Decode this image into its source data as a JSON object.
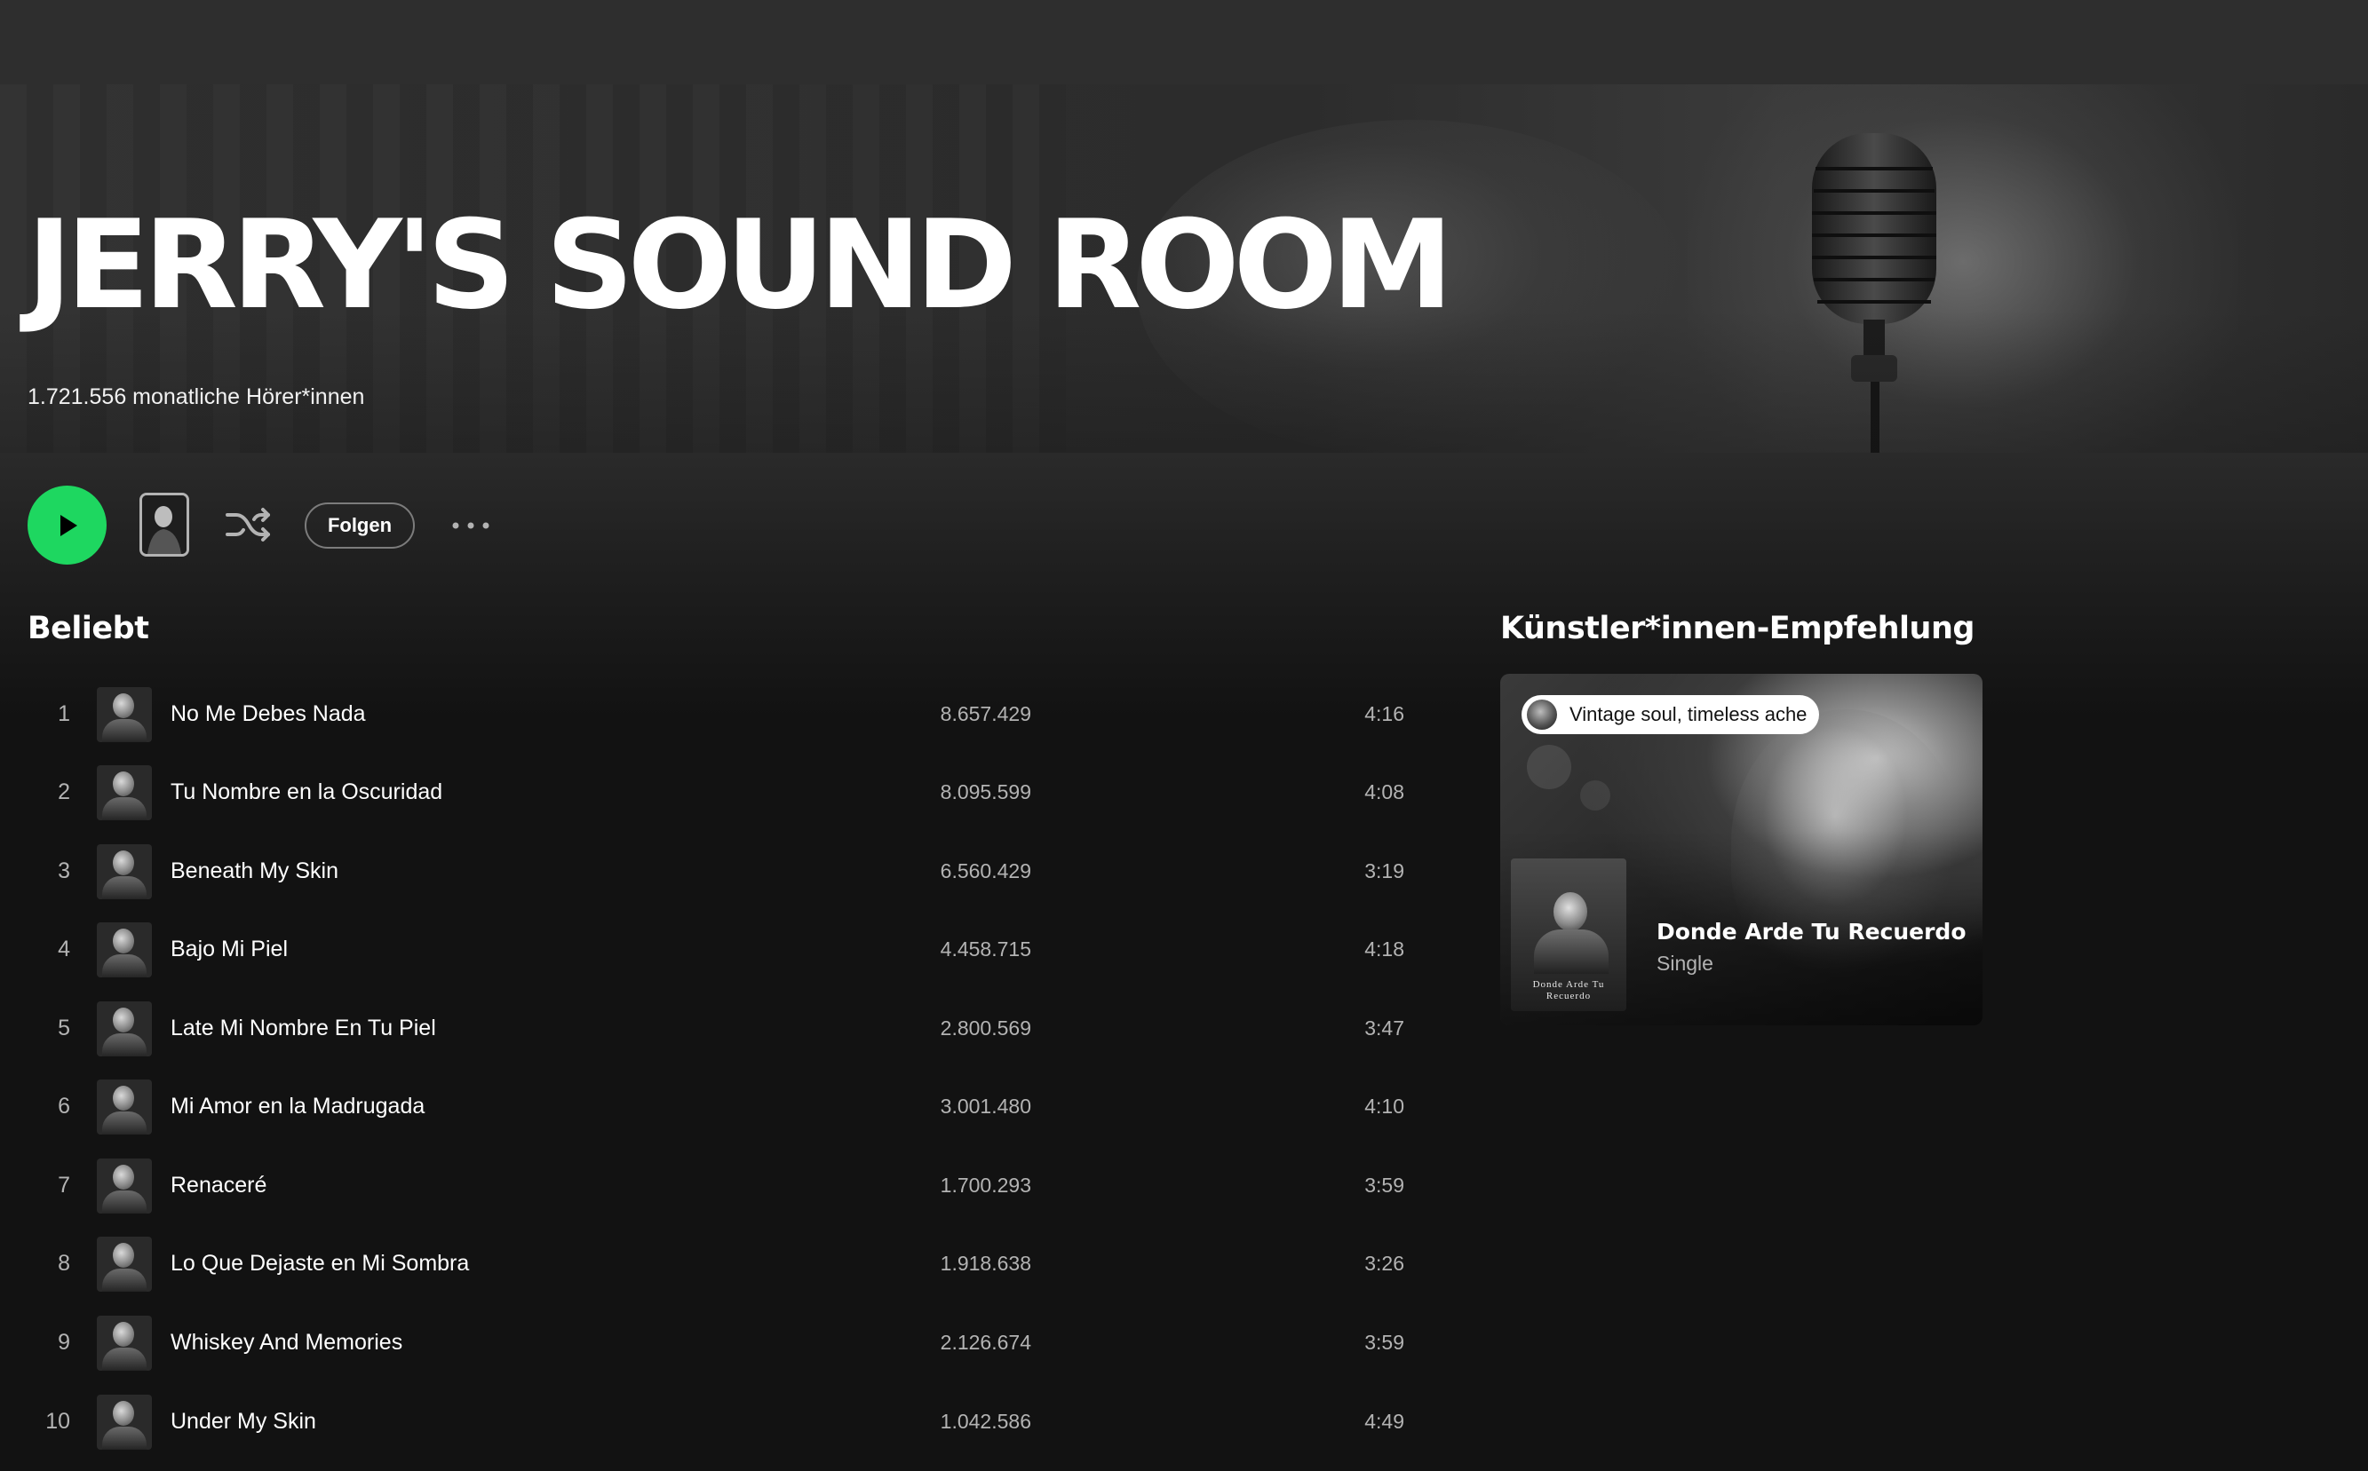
{
  "artist": {
    "name": "JERRY'S SOUND ROOM",
    "monthly_listeners": "1.721.556 monatliche Hörer*innen"
  },
  "controls": {
    "play": "play-icon",
    "shuffle": "shuffle-icon",
    "follow_label": "Folgen",
    "more": "more-options-icon",
    "accent_color": "#1ed760"
  },
  "popular": {
    "title": "Beliebt",
    "tracks": [
      {
        "rank": "1",
        "title": "No Me Debes Nada",
        "plays": "8.657.429",
        "duration": "4:16"
      },
      {
        "rank": "2",
        "title": "Tu Nombre en la Oscuridad",
        "plays": "8.095.599",
        "duration": "4:08"
      },
      {
        "rank": "3",
        "title": "Beneath My Skin",
        "plays": "6.560.429",
        "duration": "3:19"
      },
      {
        "rank": "4",
        "title": "Bajo Mi Piel",
        "plays": "4.458.715",
        "duration": "4:18"
      },
      {
        "rank": "5",
        "title": "Late Mi Nombre En Tu Piel",
        "plays": "2.800.569",
        "duration": "3:47"
      },
      {
        "rank": "6",
        "title": "Mi Amor en la Madrugada",
        "plays": "3.001.480",
        "duration": "4:10"
      },
      {
        "rank": "7",
        "title": "Renaceré",
        "plays": "1.700.293",
        "duration": "3:59"
      },
      {
        "rank": "8",
        "title": "Lo Que Dejaste en Mi Sombra",
        "plays": "1.918.638",
        "duration": "3:26"
      },
      {
        "rank": "9",
        "title": "Whiskey And Memories",
        "plays": "2.126.674",
        "duration": "3:59"
      },
      {
        "rank": "10",
        "title": "Under My Skin",
        "plays": "1.042.586",
        "duration": "4:49"
      }
    ]
  },
  "recommendation": {
    "title": "Künstler*innen-Empfehlung",
    "tagline": "Vintage soul, timeless ache",
    "release_title": "Donde Arde Tu Recuerdo",
    "release_type": "Single",
    "cover_text": "Donde Arde Tu Recuerdo"
  }
}
